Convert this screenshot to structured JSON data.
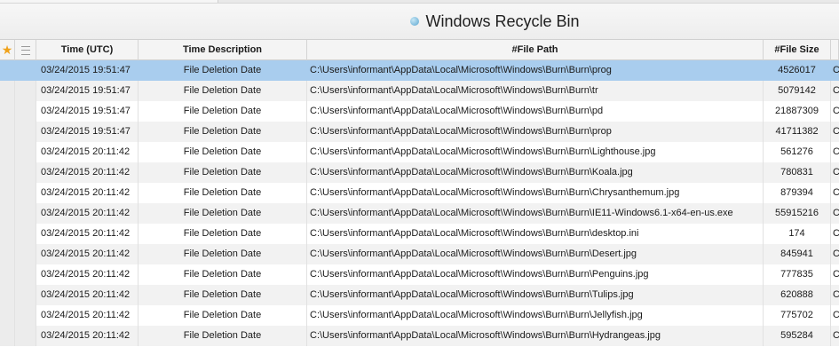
{
  "window": {
    "title": "Windows Recycle Bin",
    "title_icon": "recycle-bin-icon"
  },
  "table": {
    "header_icons": [
      "star-icon",
      "lines-icon"
    ],
    "columns": [
      "Time (UTC)",
      "Time Description",
      "#File Path",
      "#File Size",
      ""
    ],
    "rows": [
      {
        "time": "03/24/2015 19:51:47",
        "desc": "File Deletion Date",
        "path": "C:\\Users\\informant\\AppData\\Local\\Microsoft\\Windows\\Burn\\Burn\\prog",
        "size": "4526017",
        "extra": "C"
      },
      {
        "time": "03/24/2015 19:51:47",
        "desc": "File Deletion Date",
        "path": "C:\\Users\\informant\\AppData\\Local\\Microsoft\\Windows\\Burn\\Burn\\tr",
        "size": "5079142",
        "extra": "C"
      },
      {
        "time": "03/24/2015 19:51:47",
        "desc": "File Deletion Date",
        "path": "C:\\Users\\informant\\AppData\\Local\\Microsoft\\Windows\\Burn\\Burn\\pd",
        "size": "21887309",
        "extra": "C"
      },
      {
        "time": "03/24/2015 19:51:47",
        "desc": "File Deletion Date",
        "path": "C:\\Users\\informant\\AppData\\Local\\Microsoft\\Windows\\Burn\\Burn\\prop",
        "size": "41711382",
        "extra": "C"
      },
      {
        "time": "03/24/2015 20:11:42",
        "desc": "File Deletion Date",
        "path": "C:\\Users\\informant\\AppData\\Local\\Microsoft\\Windows\\Burn\\Burn\\Lighthouse.jpg",
        "size": "561276",
        "extra": "C"
      },
      {
        "time": "03/24/2015 20:11:42",
        "desc": "File Deletion Date",
        "path": "C:\\Users\\informant\\AppData\\Local\\Microsoft\\Windows\\Burn\\Burn\\Koala.jpg",
        "size": "780831",
        "extra": "C"
      },
      {
        "time": "03/24/2015 20:11:42",
        "desc": "File Deletion Date",
        "path": "C:\\Users\\informant\\AppData\\Local\\Microsoft\\Windows\\Burn\\Burn\\Chrysanthemum.jpg",
        "size": "879394",
        "extra": "C"
      },
      {
        "time": "03/24/2015 20:11:42",
        "desc": "File Deletion Date",
        "path": "C:\\Users\\informant\\AppData\\Local\\Microsoft\\Windows\\Burn\\Burn\\IE11-Windows6.1-x64-en-us.exe",
        "size": "55915216",
        "extra": "C"
      },
      {
        "time": "03/24/2015 20:11:42",
        "desc": "File Deletion Date",
        "path": "C:\\Users\\informant\\AppData\\Local\\Microsoft\\Windows\\Burn\\Burn\\desktop.ini",
        "size": "174",
        "extra": "C"
      },
      {
        "time": "03/24/2015 20:11:42",
        "desc": "File Deletion Date",
        "path": "C:\\Users\\informant\\AppData\\Local\\Microsoft\\Windows\\Burn\\Burn\\Desert.jpg",
        "size": "845941",
        "extra": "C"
      },
      {
        "time": "03/24/2015 20:11:42",
        "desc": "File Deletion Date",
        "path": "C:\\Users\\informant\\AppData\\Local\\Microsoft\\Windows\\Burn\\Burn\\Penguins.jpg",
        "size": "777835",
        "extra": "C"
      },
      {
        "time": "03/24/2015 20:11:42",
        "desc": "File Deletion Date",
        "path": "C:\\Users\\informant\\AppData\\Local\\Microsoft\\Windows\\Burn\\Burn\\Tulips.jpg",
        "size": "620888",
        "extra": "C"
      },
      {
        "time": "03/24/2015 20:11:42",
        "desc": "File Deletion Date",
        "path": "C:\\Users\\informant\\AppData\\Local\\Microsoft\\Windows\\Burn\\Burn\\Jellyfish.jpg",
        "size": "775702",
        "extra": "C"
      },
      {
        "time": "03/24/2015 20:11:42",
        "desc": "File Deletion Date",
        "path": "C:\\Users\\informant\\AppData\\Local\\Microsoft\\Windows\\Burn\\Burn\\Hydrangeas.jpg",
        "size": "595284",
        "extra": "C"
      }
    ]
  },
  "colors": {
    "selected_row": "#a9cdee",
    "alt_row": "#f2f2f2",
    "star": "#f0a21a"
  }
}
